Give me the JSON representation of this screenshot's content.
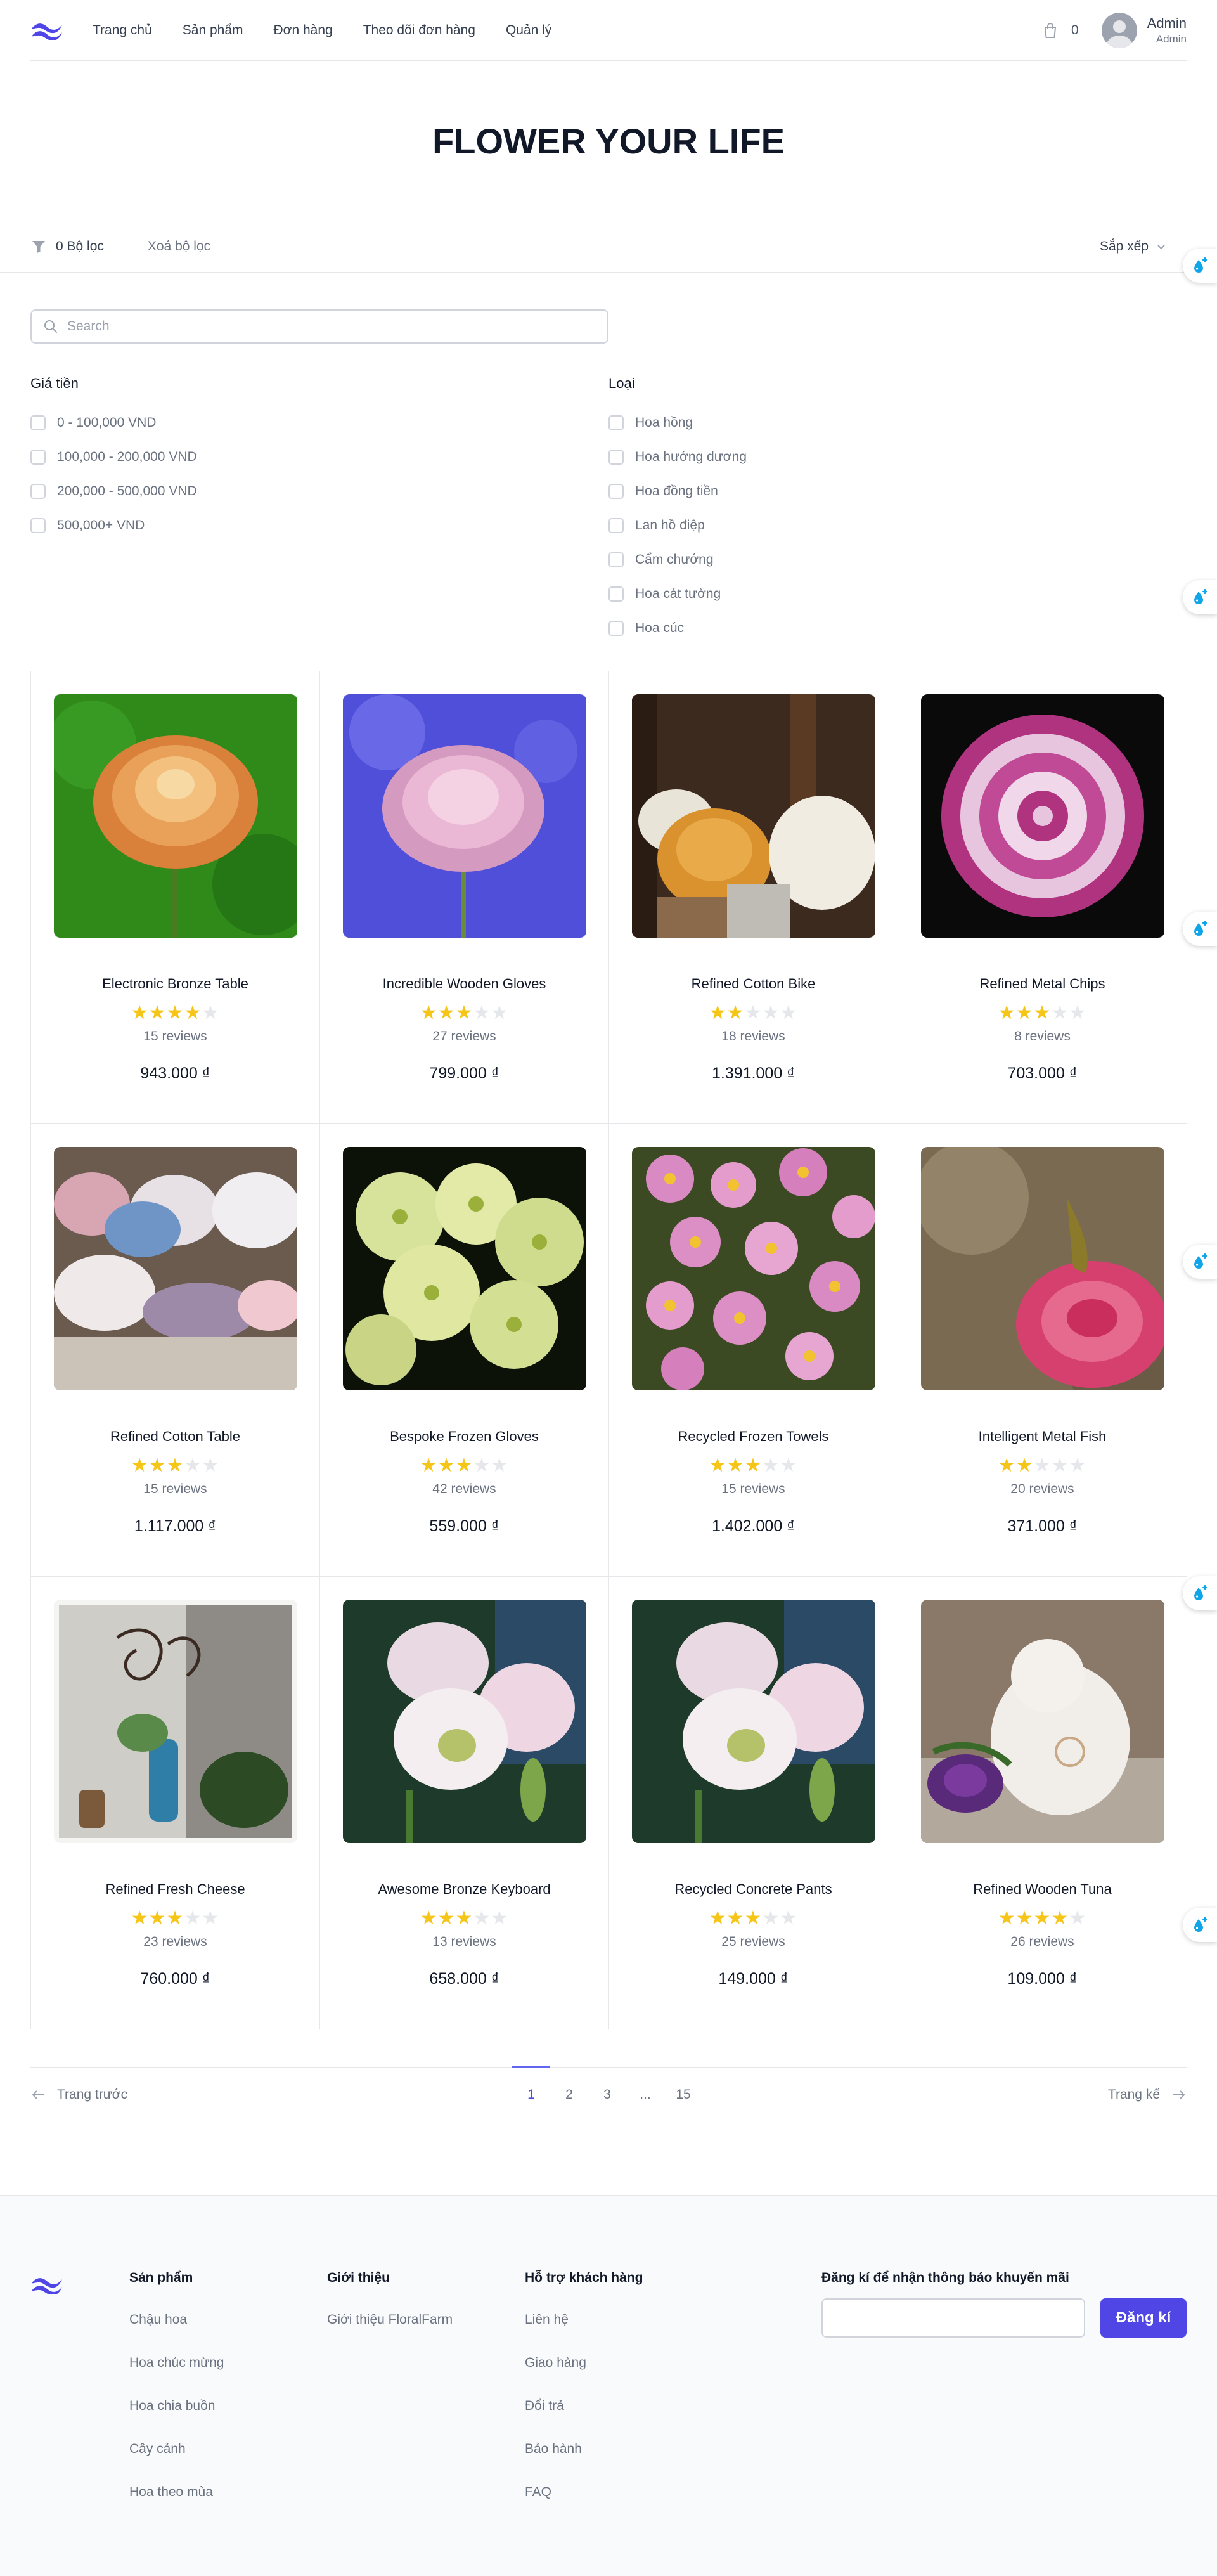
{
  "colors": {
    "accent": "#4f46e5",
    "star_on": "#f5c518",
    "star_off": "#e5e7eb"
  },
  "nav": {
    "items": [
      {
        "label": "Trang chủ"
      },
      {
        "label": "Sản phẩm"
      },
      {
        "label": "Đơn hàng"
      },
      {
        "label": "Theo dõi đơn hàng"
      },
      {
        "label": "Quản lý"
      }
    ],
    "cart_count": "0",
    "user": {
      "name": "Admin",
      "role": "Admin"
    }
  },
  "hero": {
    "title": "FLOWER YOUR LIFE"
  },
  "filter_bar": {
    "count_label": "0 Bộ lọc",
    "clear_label": "Xoá bộ lọc",
    "sort_label": "Sắp xếp"
  },
  "search": {
    "placeholder": "Search",
    "value": ""
  },
  "filters": {
    "price": {
      "title": "Giá tiền",
      "options": [
        {
          "label": "0 - 100,000 VND"
        },
        {
          "label": "100,000 - 200,000 VND"
        },
        {
          "label": "200,000 - 500,000 VND"
        },
        {
          "label": "500,000+ VND"
        }
      ]
    },
    "type": {
      "title": "Loại",
      "options": [
        {
          "label": "Hoa hồng"
        },
        {
          "label": "Hoa hướng dương"
        },
        {
          "label": "Hoa đồng tiền"
        },
        {
          "label": "Lan hồ điệp"
        },
        {
          "label": "Cẩm chướng"
        },
        {
          "label": "Hoa cát tường"
        },
        {
          "label": "Hoa cúc"
        }
      ]
    }
  },
  "products": [
    {
      "name": "Electronic Bronze Table",
      "rating": 4,
      "reviews": "15 reviews",
      "price": "943.000 ₫"
    },
    {
      "name": "Incredible Wooden Gloves",
      "rating": 3,
      "reviews": "27 reviews",
      "price": "799.000 ₫"
    },
    {
      "name": "Refined Cotton Bike",
      "rating": 2,
      "reviews": "18 reviews",
      "price": "1.391.000 ₫"
    },
    {
      "name": "Refined Metal Chips",
      "rating": 3,
      "reviews": "8 reviews",
      "price": "703.000 ₫"
    },
    {
      "name": "Refined Cotton Table",
      "rating": 3,
      "reviews": "15 reviews",
      "price": "1.117.000 ₫"
    },
    {
      "name": "Bespoke Frozen Gloves",
      "rating": 3,
      "reviews": "42 reviews",
      "price": "559.000 ₫"
    },
    {
      "name": "Recycled Frozen Towels",
      "rating": 3,
      "reviews": "15 reviews",
      "price": "1.402.000 ₫"
    },
    {
      "name": "Intelligent Metal Fish",
      "rating": 2,
      "reviews": "20 reviews",
      "price": "371.000 ₫"
    },
    {
      "name": "Refined Fresh Cheese",
      "rating": 3,
      "reviews": "23 reviews",
      "price": "760.000 ₫"
    },
    {
      "name": "Awesome Bronze Keyboard",
      "rating": 3,
      "reviews": "13 reviews",
      "price": "658.000 ₫"
    },
    {
      "name": "Recycled Concrete Pants",
      "rating": 3,
      "reviews": "25 reviews",
      "price": "149.000 ₫"
    },
    {
      "name": "Refined Wooden Tuna",
      "rating": 4,
      "reviews": "26 reviews",
      "price": "109.000 ₫"
    }
  ],
  "pagination": {
    "prev_label": "Trang trước",
    "next_label": "Trang kế",
    "pages": [
      "1",
      "2",
      "3",
      "...",
      "15"
    ],
    "current": "1"
  },
  "footer": {
    "col1": {
      "title": "Sản phẩm",
      "links": [
        "Chậu hoa",
        "Hoa chúc mừng",
        "Hoa chia buồn",
        "Cây cảnh",
        "Hoa theo mùa"
      ]
    },
    "col2": {
      "title": "Giới thiệu",
      "links": [
        "Giới thiệu FloralFarm"
      ]
    },
    "col3": {
      "title": "Hỗ trợ khách hàng",
      "links": [
        "Liên hệ",
        "Giao hàng",
        "Đổi trả",
        "Bảo hành",
        "FAQ"
      ]
    },
    "newsletter": {
      "title": "Đăng kí để nhận thông báo khuyến mãi",
      "input_value": "",
      "button_label": "Đăng kí"
    }
  }
}
